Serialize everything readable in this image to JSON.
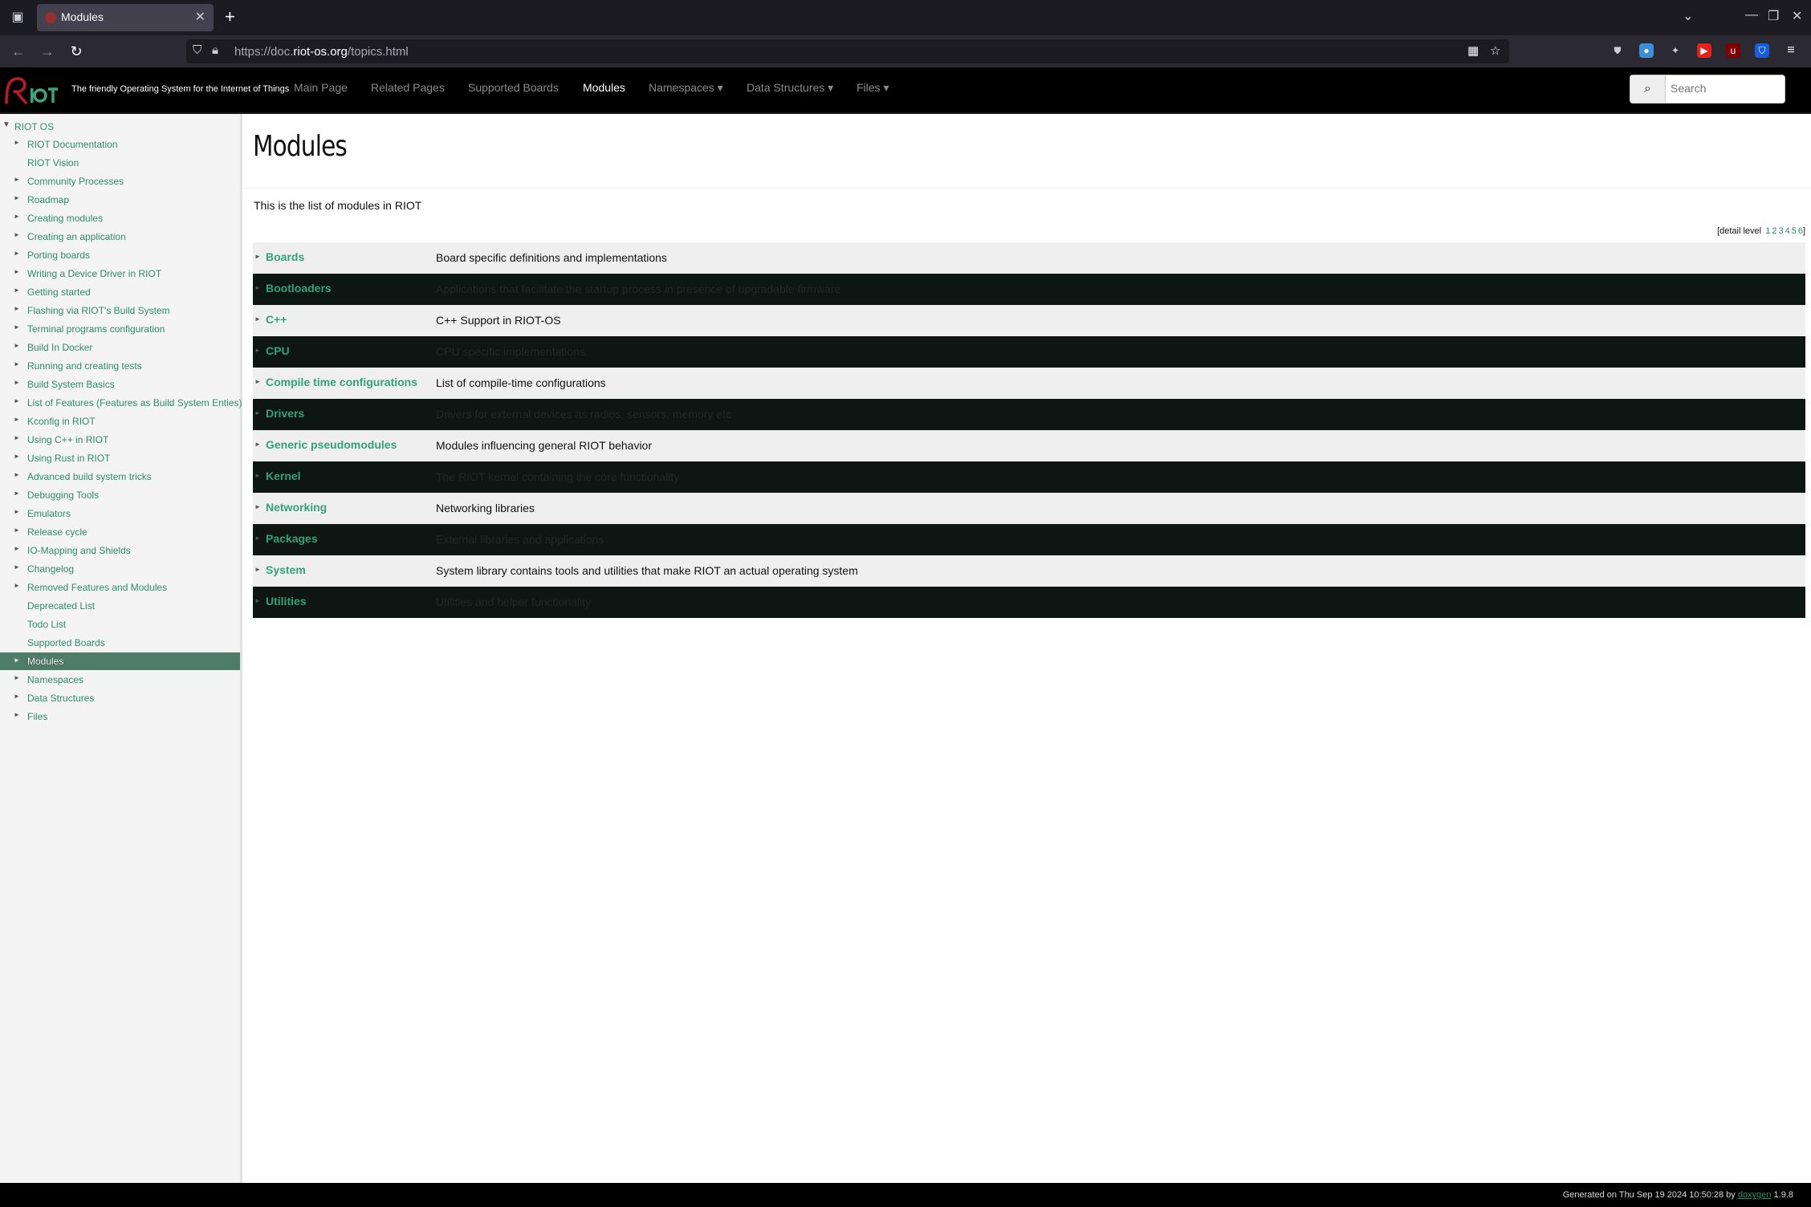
{
  "browser": {
    "tab_title": "Modules",
    "new_tab": "+",
    "url_prefix": "https://doc.",
    "url_host": "riot-os.org",
    "url_path": "/topics.html"
  },
  "header": {
    "tagline": "The friendly Operating System for the Internet of Things",
    "menu": [
      {
        "label": "Main Page"
      },
      {
        "label": "Related Pages"
      },
      {
        "label": "Supported Boards"
      },
      {
        "label": "Modules"
      },
      {
        "label": "Namespaces ▾"
      },
      {
        "label": "Data Structures ▾"
      },
      {
        "label": "Files ▾"
      }
    ],
    "search_placeholder": "Search"
  },
  "sidebar": {
    "root": "RIOT OS",
    "items": [
      {
        "label": "RIOT Documentation",
        "arrow": "►"
      },
      {
        "label": "RIOT Vision",
        "arrow": ""
      },
      {
        "label": "Community Processes",
        "arrow": "►"
      },
      {
        "label": "Roadmap",
        "arrow": "►"
      },
      {
        "label": "Creating modules",
        "arrow": "►"
      },
      {
        "label": "Creating an application",
        "arrow": "►"
      },
      {
        "label": "Porting boards",
        "arrow": "►"
      },
      {
        "label": "Writing a Device Driver in RIOT",
        "arrow": "►"
      },
      {
        "label": "Getting started",
        "arrow": "►"
      },
      {
        "label": "Flashing via RIOT's Build System",
        "arrow": "►"
      },
      {
        "label": "Terminal programs configuration",
        "arrow": "►"
      },
      {
        "label": "Build In Docker",
        "arrow": "►"
      },
      {
        "label": "Running and creating tests",
        "arrow": "►"
      },
      {
        "label": "Build System Basics",
        "arrow": "►"
      },
      {
        "label": "List of Features (Features as Build System Enties)",
        "arrow": "►"
      },
      {
        "label": "Kconfig in RIOT",
        "arrow": "►"
      },
      {
        "label": "Using C++ in RIOT",
        "arrow": "►"
      },
      {
        "label": "Using Rust in RIOT",
        "arrow": "►"
      },
      {
        "label": "Advanced build system tricks",
        "arrow": "►"
      },
      {
        "label": "Debugging Tools",
        "arrow": "►"
      },
      {
        "label": "Emulators",
        "arrow": "►"
      },
      {
        "label": "Release cycle",
        "arrow": "►"
      },
      {
        "label": "IO-Mapping and Shields",
        "arrow": "►"
      },
      {
        "label": "Changelog",
        "arrow": "►"
      },
      {
        "label": "Removed Features and Modules",
        "arrow": "►"
      },
      {
        "label": "Deprecated List",
        "arrow": ""
      },
      {
        "label": "Todo List",
        "arrow": ""
      },
      {
        "label": "Supported Boards",
        "arrow": ""
      },
      {
        "label": "Modules",
        "arrow": "►"
      },
      {
        "label": "Namespaces",
        "arrow": "►"
      },
      {
        "label": "Data Structures",
        "arrow": "►"
      },
      {
        "label": "Files",
        "arrow": "►"
      }
    ]
  },
  "content": {
    "title": "Modules",
    "intro": "This is the list of modules in RIOT",
    "detail_level_prefix": "[detail level",
    "detail_levels": [
      "1",
      "2",
      "3",
      "4",
      "5",
      "6"
    ],
    "detail_level_suffix": "]",
    "modules": [
      {
        "name": "Boards",
        "desc": "Board specific definitions and implementations"
      },
      {
        "name": "Bootloaders",
        "desc": "Applications that facilitate the startup process in presence of upgradable firmware"
      },
      {
        "name": "C++",
        "desc": "C++ Support in RIOT-OS"
      },
      {
        "name": "CPU",
        "desc": "CPU specific implementations"
      },
      {
        "name": "Compile time configurations",
        "desc": "List of compile-time configurations"
      },
      {
        "name": "Drivers",
        "desc": "Drivers for external devices as radios, sensors, memory etc"
      },
      {
        "name": "Generic pseudomodules",
        "desc": "Modules influencing general RIOT behavior"
      },
      {
        "name": "Kernel",
        "desc": "The RIOT kernel containing the core functionality"
      },
      {
        "name": "Networking",
        "desc": "Networking libraries"
      },
      {
        "name": "Packages",
        "desc": "External libraries and applications"
      },
      {
        "name": "System",
        "desc": "System library contains tools and utilities that make RIOT an actual operating system"
      },
      {
        "name": "Utilities",
        "desc": "Utilities and helper functionality"
      }
    ]
  },
  "footer": {
    "generated": "Generated on Thu Sep 19 2024 10:50:28 by",
    "tool": "doxygen",
    "version": "1.9.8"
  },
  "colors": {
    "accent": "#2e8b6b",
    "selected_bg": "#4d7d69",
    "dark_row": "#0d1612",
    "light_row": "#efefef"
  }
}
